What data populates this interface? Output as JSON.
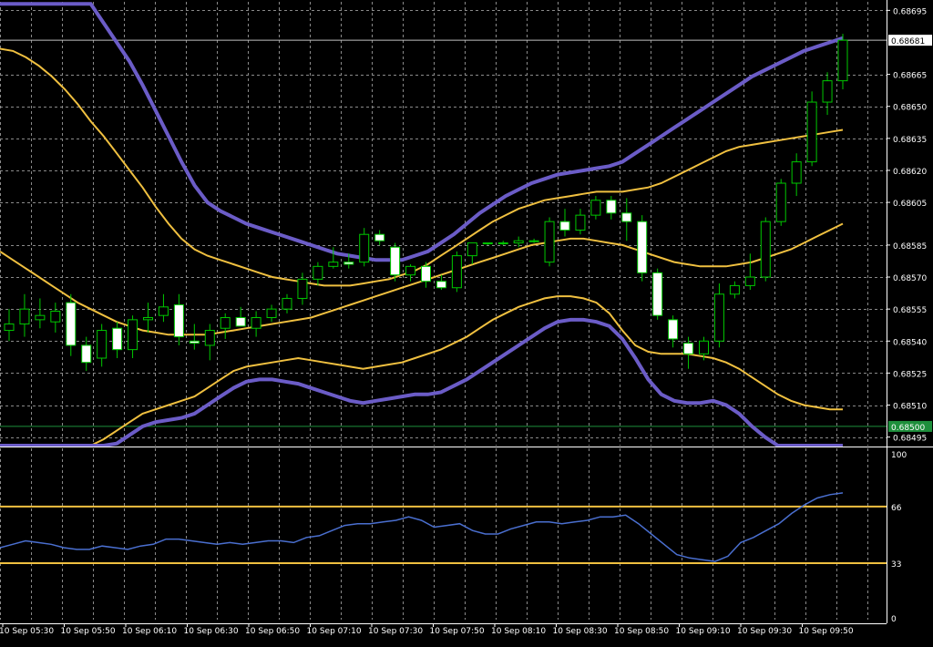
{
  "colors": {
    "background": "#000000",
    "grid": "#8a8a8a",
    "axis": "#ffffff",
    "candle_up_border": "#00c800",
    "candle_down_border": "#00c800",
    "candle_up_fill": "#000000",
    "candle_down_fill": "#ffffff",
    "bollinger_outer": "#6b5cc7",
    "bollinger_inner": "#f0c040",
    "moving_average": "#f0c040",
    "indicator_line": "#4a6fd0",
    "level_line": "#f0c040",
    "price_tag_bg": "#ffffff",
    "price_tag_current_bg": "#1e8f3c"
  },
  "chart_data": [
    {
      "type": "candlestick",
      "panel": "price",
      "y_ticks": [
        "0.68695",
        "0.68665",
        "0.68650",
        "0.68635",
        "0.68620",
        "0.68605",
        "0.68585",
        "0.68570",
        "0.68555",
        "0.68540",
        "0.68525",
        "0.68510",
        "0.68495"
      ],
      "y_tick_values": [
        0.68695,
        0.68665,
        0.6865,
        0.68635,
        0.6862,
        0.68605,
        0.68585,
        0.6857,
        0.68555,
        0.6854,
        0.68525,
        0.6851,
        0.68495
      ],
      "ylim": [
        0.68491,
        0.68699
      ],
      "price_tags": [
        {
          "label": "0.68681",
          "value": 0.68681,
          "style": "white"
        },
        {
          "label": "0.68500",
          "value": 0.685,
          "style": "green"
        }
      ],
      "candles": [
        {
          "o": 0.68545,
          "h": 0.68555,
          "l": 0.6854,
          "c": 0.68548
        },
        {
          "o": 0.68548,
          "h": 0.68562,
          "l": 0.68542,
          "c": 0.68555
        },
        {
          "o": 0.6855,
          "h": 0.6856,
          "l": 0.68546,
          "c": 0.68552
        },
        {
          "o": 0.68549,
          "h": 0.68558,
          "l": 0.68544,
          "c": 0.68554
        },
        {
          "o": 0.68558,
          "h": 0.68562,
          "l": 0.68533,
          "c": 0.68538
        },
        {
          "o": 0.68538,
          "h": 0.68542,
          "l": 0.68526,
          "c": 0.6853
        },
        {
          "o": 0.68532,
          "h": 0.68548,
          "l": 0.68528,
          "c": 0.68545
        },
        {
          "o": 0.68546,
          "h": 0.68549,
          "l": 0.68532,
          "c": 0.68536
        },
        {
          "o": 0.68536,
          "h": 0.68552,
          "l": 0.68532,
          "c": 0.6855
        },
        {
          "o": 0.6855,
          "h": 0.68558,
          "l": 0.68544,
          "c": 0.68551
        },
        {
          "o": 0.68552,
          "h": 0.68562,
          "l": 0.68549,
          "c": 0.68556
        },
        {
          "o": 0.68557,
          "h": 0.68562,
          "l": 0.68538,
          "c": 0.68542
        },
        {
          "o": 0.6854,
          "h": 0.68548,
          "l": 0.68536,
          "c": 0.68539
        },
        {
          "o": 0.68538,
          "h": 0.68548,
          "l": 0.68531,
          "c": 0.68545
        },
        {
          "o": 0.68546,
          "h": 0.68553,
          "l": 0.68541,
          "c": 0.68551
        },
        {
          "o": 0.68551,
          "h": 0.68556,
          "l": 0.68547,
          "c": 0.68547
        },
        {
          "o": 0.68546,
          "h": 0.68554,
          "l": 0.68542,
          "c": 0.68551
        },
        {
          "o": 0.68551,
          "h": 0.68557,
          "l": 0.68549,
          "c": 0.68555
        },
        {
          "o": 0.68555,
          "h": 0.68562,
          "l": 0.68553,
          "c": 0.6856
        },
        {
          "o": 0.6856,
          "h": 0.68572,
          "l": 0.68557,
          "c": 0.68569
        },
        {
          "o": 0.68569,
          "h": 0.68577,
          "l": 0.68566,
          "c": 0.68575
        },
        {
          "o": 0.68575,
          "h": 0.68584,
          "l": 0.68574,
          "c": 0.68577
        },
        {
          "o": 0.68577,
          "h": 0.68581,
          "l": 0.68574,
          "c": 0.68576
        },
        {
          "o": 0.68577,
          "h": 0.68593,
          "l": 0.68575,
          "c": 0.6859
        },
        {
          "o": 0.6859,
          "h": 0.68592,
          "l": 0.68585,
          "c": 0.68587
        },
        {
          "o": 0.68584,
          "h": 0.68586,
          "l": 0.68568,
          "c": 0.68571
        },
        {
          "o": 0.68571,
          "h": 0.68576,
          "l": 0.68568,
          "c": 0.68575
        },
        {
          "o": 0.68575,
          "h": 0.68577,
          "l": 0.68565,
          "c": 0.68568
        },
        {
          "o": 0.68568,
          "h": 0.68571,
          "l": 0.68564,
          "c": 0.68565
        },
        {
          "o": 0.68565,
          "h": 0.68582,
          "l": 0.68563,
          "c": 0.6858
        },
        {
          "o": 0.6858,
          "h": 0.68586,
          "l": 0.68576,
          "c": 0.68586
        },
        {
          "o": 0.68586,
          "h": 0.68586,
          "l": 0.68585,
          "c": 0.68586
        },
        {
          "o": 0.68586,
          "h": 0.68587,
          "l": 0.68585,
          "c": 0.68586
        },
        {
          "o": 0.68586,
          "h": 0.68589,
          "l": 0.68584,
          "c": 0.68587
        },
        {
          "o": 0.68587,
          "h": 0.68588,
          "l": 0.68586,
          "c": 0.68587
        },
        {
          "o": 0.68577,
          "h": 0.68598,
          "l": 0.68575,
          "c": 0.68596
        },
        {
          "o": 0.68596,
          "h": 0.68602,
          "l": 0.68589,
          "c": 0.68592
        },
        {
          "o": 0.68592,
          "h": 0.68602,
          "l": 0.6859,
          "c": 0.68599
        },
        {
          "o": 0.68599,
          "h": 0.68608,
          "l": 0.68597,
          "c": 0.68606
        },
        {
          "o": 0.68606,
          "h": 0.68608,
          "l": 0.68597,
          "c": 0.686
        },
        {
          "o": 0.686,
          "h": 0.68607,
          "l": 0.68587,
          "c": 0.68596
        },
        {
          "o": 0.68596,
          "h": 0.68599,
          "l": 0.68568,
          "c": 0.68572
        },
        {
          "o": 0.68572,
          "h": 0.68574,
          "l": 0.6855,
          "c": 0.68552
        },
        {
          "o": 0.6855,
          "h": 0.68552,
          "l": 0.68537,
          "c": 0.68541
        },
        {
          "o": 0.68539,
          "h": 0.68542,
          "l": 0.68527,
          "c": 0.68534
        },
        {
          "o": 0.68534,
          "h": 0.68542,
          "l": 0.68531,
          "c": 0.6854
        },
        {
          "o": 0.6854,
          "h": 0.68567,
          "l": 0.68537,
          "c": 0.68562
        },
        {
          "o": 0.68562,
          "h": 0.68568,
          "l": 0.6856,
          "c": 0.68566
        },
        {
          "o": 0.68566,
          "h": 0.68581,
          "l": 0.68564,
          "c": 0.6857
        },
        {
          "o": 0.6857,
          "h": 0.68598,
          "l": 0.68568,
          "c": 0.68596
        },
        {
          "o": 0.68596,
          "h": 0.68616,
          "l": 0.68594,
          "c": 0.68614
        },
        {
          "o": 0.68614,
          "h": 0.68628,
          "l": 0.68608,
          "c": 0.68624
        },
        {
          "o": 0.68624,
          "h": 0.68657,
          "l": 0.68622,
          "c": 0.68652
        },
        {
          "o": 0.68652,
          "h": 0.68666,
          "l": 0.68646,
          "c": 0.68662
        },
        {
          "o": 0.68662,
          "h": 0.68684,
          "l": 0.68658,
          "c": 0.68681
        }
      ],
      "overlay_series": [
        {
          "role": "bollinger-upper-outer",
          "values": [
            0.68698,
            0.68698,
            0.68698,
            0.68698,
            0.68698,
            0.68698,
            0.68698,
            0.68698,
            0.68689,
            0.6868,
            0.68671,
            0.6866,
            0.68648,
            0.68636,
            0.68624,
            0.68613,
            0.68605,
            0.68601,
            0.68598,
            0.68595,
            0.68593,
            0.68591,
            0.68589,
            0.68587,
            0.68585,
            0.68583,
            0.68581,
            0.6858,
            0.68579,
            0.68578,
            0.68578,
            0.68578,
            0.6858,
            0.68582,
            0.68586,
            0.6859,
            0.68595,
            0.686,
            0.68604,
            0.68608,
            0.68611,
            0.68614,
            0.68616,
            0.68618,
            0.68619,
            0.6862,
            0.68621,
            0.68622,
            0.68624,
            0.68628,
            0.68632,
            0.68636,
            0.6864,
            0.68644,
            0.68648,
            0.68652,
            0.68656,
            0.6866,
            0.68664,
            0.68667,
            0.6867,
            0.68673,
            0.68676,
            0.68678,
            0.6868,
            0.68682
          ]
        },
        {
          "role": "bollinger-upper-inner",
          "values": [
            0.68677,
            0.68676,
            0.68673,
            0.68669,
            0.68664,
            0.68658,
            0.68651,
            0.68643,
            0.68636,
            0.68628,
            0.6862,
            0.68612,
            0.68603,
            0.68595,
            0.68588,
            0.68583,
            0.6858,
            0.68578,
            0.68576,
            0.68574,
            0.68572,
            0.6857,
            0.68569,
            0.68568,
            0.68567,
            0.68566,
            0.68566,
            0.68566,
            0.68567,
            0.68568,
            0.68569,
            0.68571,
            0.68573,
            0.68576,
            0.6858,
            0.68584,
            0.68588,
            0.68592,
            0.68596,
            0.68599,
            0.68602,
            0.68604,
            0.68606,
            0.68607,
            0.68608,
            0.68609,
            0.6861,
            0.6861,
            0.6861,
            0.68611,
            0.68612,
            0.68614,
            0.68617,
            0.6862,
            0.68623,
            0.68626,
            0.68629,
            0.68631,
            0.68632,
            0.68633,
            0.68634,
            0.68635,
            0.68636,
            0.68637,
            0.68638,
            0.68639
          ]
        },
        {
          "role": "moving-average",
          "values": [
            0.68582,
            0.68578,
            0.68574,
            0.6857,
            0.68566,
            0.68562,
            0.68558,
            0.68555,
            0.68552,
            0.68549,
            0.68547,
            0.68545,
            0.68544,
            0.68543,
            0.68543,
            0.68543,
            0.68543,
            0.68544,
            0.68545,
            0.68546,
            0.68547,
            0.68548,
            0.68549,
            0.6855,
            0.68551,
            0.68553,
            0.68555,
            0.68557,
            0.68559,
            0.68561,
            0.68563,
            0.68565,
            0.68567,
            0.68569,
            0.68571,
            0.68573,
            0.68575,
            0.68577,
            0.68579,
            0.68581,
            0.68583,
            0.68585,
            0.68586,
            0.68587,
            0.68588,
            0.68588,
            0.68587,
            0.68586,
            0.68585,
            0.68583,
            0.68581,
            0.68579,
            0.68577,
            0.68576,
            0.68575,
            0.68575,
            0.68575,
            0.68576,
            0.68577,
            0.68579,
            0.68581,
            0.68583,
            0.68586,
            0.68589,
            0.68592,
            0.68595
          ]
        },
        {
          "role": "bollinger-lower-inner",
          "values": [
            0.6849,
            0.6849,
            0.6849,
            0.6849,
            0.6849,
            0.6849,
            0.6849,
            0.6849,
            0.68494,
            0.68498,
            0.68502,
            0.68506,
            0.68508,
            0.6851,
            0.68512,
            0.68514,
            0.68518,
            0.68522,
            0.68526,
            0.68528,
            0.68529,
            0.6853,
            0.68531,
            0.68532,
            0.68531,
            0.6853,
            0.68529,
            0.68528,
            0.68527,
            0.68528,
            0.68529,
            0.6853,
            0.68532,
            0.68534,
            0.68536,
            0.68539,
            0.68542,
            0.68546,
            0.6855,
            0.68553,
            0.68556,
            0.68558,
            0.6856,
            0.68561,
            0.68561,
            0.6856,
            0.68558,
            0.68553,
            0.68545,
            0.68538,
            0.68535,
            0.68534,
            0.68534,
            0.68534,
            0.68533,
            0.68532,
            0.6853,
            0.68527,
            0.68523,
            0.68519,
            0.68515,
            0.68512,
            0.6851,
            0.68509,
            0.68508,
            0.68508
          ]
        },
        {
          "role": "bollinger-lower-outer",
          "values": [
            0.6849,
            0.6849,
            0.6849,
            0.6849,
            0.6849,
            0.6849,
            0.6849,
            0.6849,
            0.6849,
            0.68492,
            0.68496,
            0.685,
            0.68502,
            0.68503,
            0.68504,
            0.68506,
            0.6851,
            0.68514,
            0.68518,
            0.68521,
            0.68522,
            0.68522,
            0.68521,
            0.6852,
            0.68518,
            0.68516,
            0.68514,
            0.68512,
            0.68511,
            0.68512,
            0.68513,
            0.68514,
            0.68515,
            0.68515,
            0.68516,
            0.68519,
            0.68522,
            0.68526,
            0.6853,
            0.68534,
            0.68538,
            0.68542,
            0.68546,
            0.68549,
            0.6855,
            0.6855,
            0.68549,
            0.68547,
            0.68541,
            0.68532,
            0.68522,
            0.68515,
            0.68512,
            0.68511,
            0.68511,
            0.68512,
            0.6851,
            0.68506,
            0.685,
            0.68495,
            0.6849,
            0.6849,
            0.6849,
            0.6849,
            0.6849,
            0.6849
          ]
        }
      ]
    },
    {
      "type": "line",
      "panel": "indicator",
      "y_ticks": [
        "100",
        "66",
        "33",
        "0"
      ],
      "y_tick_values": [
        100,
        66,
        33,
        0
      ],
      "ylim": [
        0,
        100
      ],
      "level_values": [
        66,
        33
      ],
      "x_labels": [
        "10 Sep 05:30",
        "10 Sep 05:50",
        "10 Sep 06:10",
        "10 Sep 06:30",
        "10 Sep 06:50",
        "10 Sep 07:10",
        "10 Sep 07:30",
        "10 Sep 07:50",
        "10 Sep 08:10",
        "10 Sep 08:30",
        "10 Sep 08:50",
        "10 Sep 09:10",
        "10 Sep 09:30",
        "10 Sep 09:50"
      ],
      "values": [
        42,
        44,
        46,
        45,
        44,
        42,
        41,
        41,
        43,
        42,
        41,
        43,
        44,
        47,
        47,
        46,
        45,
        44,
        45,
        44,
        45,
        46,
        46,
        45,
        48,
        49,
        52,
        55,
        56,
        56,
        57,
        58,
        60,
        58,
        54,
        55,
        56,
        52,
        50,
        50,
        53,
        55,
        57,
        57,
        56,
        57,
        58,
        60,
        60,
        61,
        56,
        50,
        44,
        38,
        36,
        35,
        34,
        37,
        45,
        48,
        52,
        56,
        62,
        67,
        71,
        73,
        74
      ]
    }
  ]
}
